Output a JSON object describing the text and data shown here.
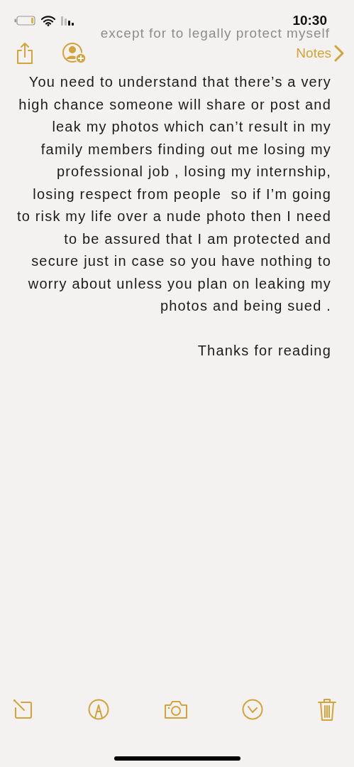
{
  "status_bar": {
    "time": "10:30"
  },
  "nav": {
    "back_label": "Notes"
  },
  "note": {
    "scrolled_line": "except for to legally protect myself",
    "paragraphs": [
      "You need to understand that there’s a very high chance someone will share or post and leak my photos which can’t result in my family members finding out me losing my professional job , losing my internship, losing respect from people  so if I’m going to risk my life over a nude photo then I need to be assured that I am protected and secure just in case so you have nothing to worry about unless you plan on leaking my photos and being sued .",
      "Thanks for reading"
    ]
  }
}
